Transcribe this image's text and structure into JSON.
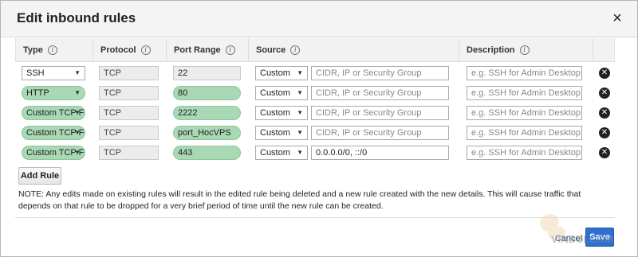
{
  "dialog": {
    "title": "Edit inbound rules",
    "close_label": "×"
  },
  "table": {
    "headers": [
      "Type",
      "Protocol",
      "Port Range",
      "Source",
      "Description"
    ],
    "rows": [
      {
        "type": "SSH",
        "protocol": "TCP",
        "port": "22",
        "source": "Custom",
        "cidr": "CIDR, IP or Security Group",
        "cidr_is_placeholder": true,
        "description": "e.g. SSH for Admin Desktop"
      },
      {
        "type": "HTTP",
        "protocol": "TCP",
        "port": "80",
        "source": "Custom",
        "cidr": "CIDR, IP or Security Group",
        "cidr_is_placeholder": true,
        "description": "e.g. SSH for Admin Desktop"
      },
      {
        "type": "Custom TCP F",
        "protocol": "TCP",
        "port": "2222",
        "source": "Custom",
        "cidr": "CIDR, IP or Security Group",
        "cidr_is_placeholder": true,
        "description": "e.g. SSH for Admin Desktop"
      },
      {
        "type": "Custom TCP F",
        "protocol": "TCP",
        "port": "port_HocVPS",
        "source": "Custom",
        "cidr": "CIDR, IP or Security Group",
        "cidr_is_placeholder": true,
        "description": "e.g. SSH for Admin Desktop"
      },
      {
        "type": "Custom TCP F",
        "protocol": "TCP",
        "port": "443",
        "source": "Custom",
        "cidr": "0.0.0.0/0, ::/0",
        "cidr_is_placeholder": false,
        "description": "e.g. SSH for Admin Desktop"
      }
    ]
  },
  "buttons": {
    "add_rule": "Add Rule",
    "cancel": "Cancel",
    "save": "Save"
  },
  "note": "NOTE: Any edits made on existing rules will result in the edited rule being deleted and a new rule created with the new details. This will cause traffic that depends on that rule to be dropped for a very brief period of time until the new rule can be created.",
  "watermark": "VINBUI.COM",
  "colors": {
    "highlight": "#a9d8b4",
    "save_button": "#2f6fd0",
    "header_bg": "#f4f4f4"
  },
  "icons": {
    "info": "info-icon",
    "delete": "delete-circle-icon",
    "close": "close-icon",
    "dropdown": "chevron-down-icon"
  }
}
